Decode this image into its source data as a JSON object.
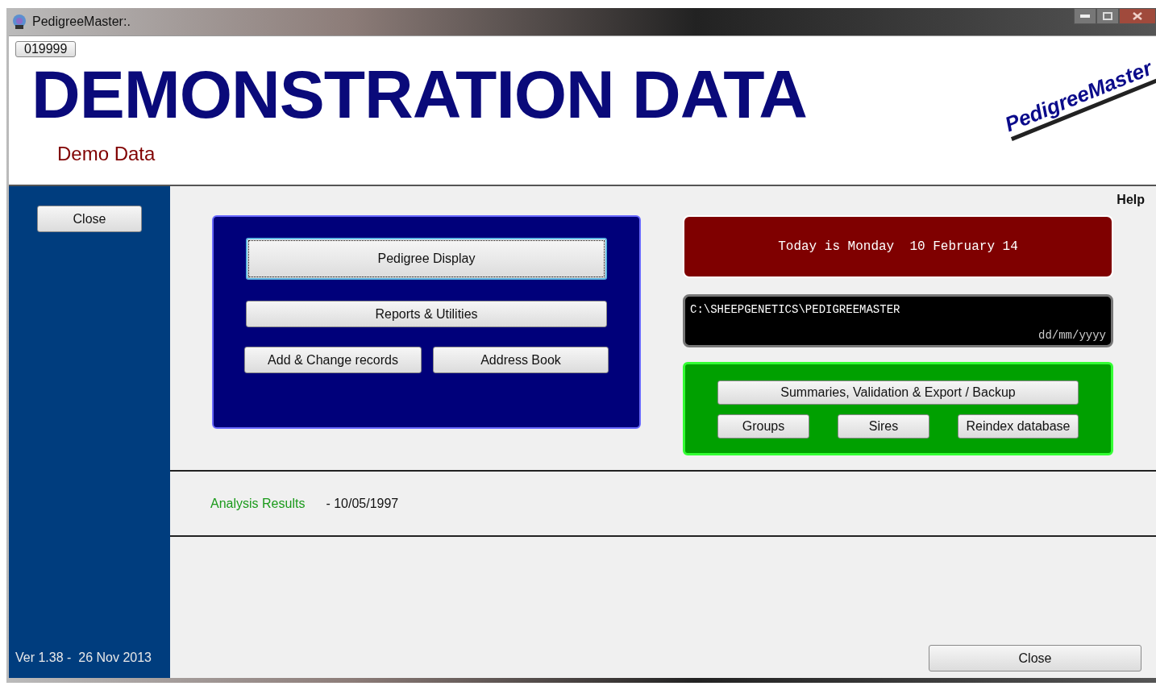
{
  "window": {
    "title": "PedigreeMaster:."
  },
  "header": {
    "badge": "019999",
    "title": "DEMONSTRATION DATA",
    "subtitle": "Demo Data",
    "logo": "PedigreeMaster"
  },
  "sidebar": {
    "close_button": "Close",
    "version": "Ver 1.38 -  26 Nov 2013"
  },
  "help": "Help",
  "main_panel": {
    "buttons": [
      {
        "label": "Pedigree Display",
        "focused": true
      },
      {
        "label": "Reports & Utilities",
        "focused": false
      }
    ],
    "pair_buttons": [
      {
        "label": "Add & Change records",
        "focused": false
      },
      {
        "label": "Address Book",
        "focused": false
      }
    ]
  },
  "date_banner": "Today is Monday  10 February 14",
  "path_box": {
    "path": "C:\\SHEEPGENETICS\\PEDIGREEMASTER",
    "date_format": "dd/mm/yyyy"
  },
  "data_panel": {
    "wide_button": "Summaries, Validation & Export / Backup",
    "buttons": [
      "Groups",
      "Sires",
      "Reindex database"
    ]
  },
  "analysis": {
    "label": "Analysis Results",
    "date": "- 10/05/1997"
  },
  "close_button": "Close"
}
